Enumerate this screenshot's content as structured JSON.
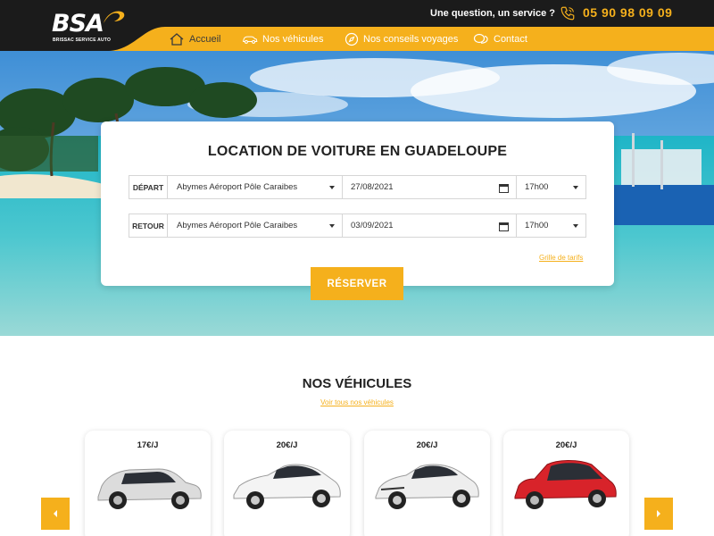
{
  "brand": {
    "logo_text": "BSA",
    "logo_subtitle": "BRISSAC SERVICE AUTO",
    "accent_color": "#f5b01c",
    "dark_color": "#1b1b1b"
  },
  "header": {
    "question": "Une question, un service ?",
    "phone": "05 90 98 09 09",
    "phone_icon": "phone-icon"
  },
  "nav": {
    "items": [
      {
        "label": "Accueil",
        "icon": "home-icon",
        "active": true
      },
      {
        "label": "Nos véhicules",
        "icon": "car-icon",
        "active": false
      },
      {
        "label": "Nos conseils voyages",
        "icon": "compass-icon",
        "active": false
      },
      {
        "label": "Contact",
        "icon": "chat-icon",
        "active": false
      }
    ]
  },
  "search": {
    "title": "LOCATION DE VOITURE EN GUADELOUPE",
    "rows": [
      {
        "label": "DÉPART",
        "place": "Abymes Aéroport Pôle Caraibes",
        "date": "27/08/2021",
        "time": "17h00"
      },
      {
        "label": "RETOUR",
        "place": "Abymes Aéroport Pôle Caraibes",
        "date": "03/09/2021",
        "time": "17h00"
      }
    ],
    "tarifs_link": "Grille de tarifs",
    "submit_label": "RÉSERVER"
  },
  "vehicles": {
    "title": "NOS VÉHICULES",
    "link": "Voir tous nos véhicules",
    "cars": [
      {
        "price": "17€/J",
        "color": "#dcdcdc"
      },
      {
        "price": "20€/J",
        "color": "#f4f4f4"
      },
      {
        "price": "20€/J",
        "color": "#eeeeee"
      },
      {
        "price": "20€/J",
        "color": "#d8232a"
      }
    ],
    "prev_icon": "chevron-left-icon",
    "next_icon": "chevron-right-icon"
  }
}
